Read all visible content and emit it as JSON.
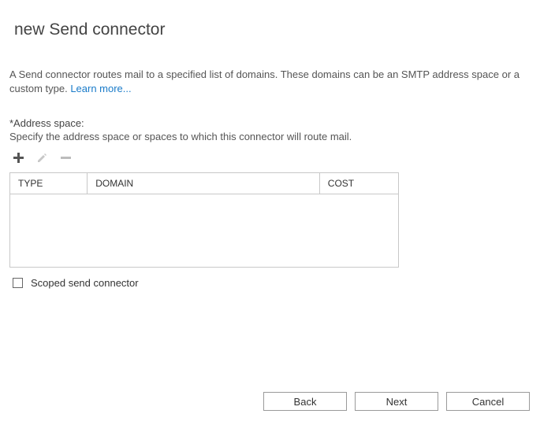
{
  "title": "new Send connector",
  "description_prefix": "A Send connector routes mail to a specified list of domains. These domains can be an SMTP address space or a custom type. ",
  "learn_more_label": "Learn more...",
  "address_space": {
    "label": "*Address space:",
    "hint": "Specify the address space or spaces to which this connector will route mail."
  },
  "table": {
    "columns": {
      "type": "TYPE",
      "domain": "DOMAIN",
      "cost": "COST"
    },
    "rows": []
  },
  "scoped_label": "Scoped send connector",
  "buttons": {
    "back": "Back",
    "next": "Next",
    "cancel": "Cancel"
  }
}
